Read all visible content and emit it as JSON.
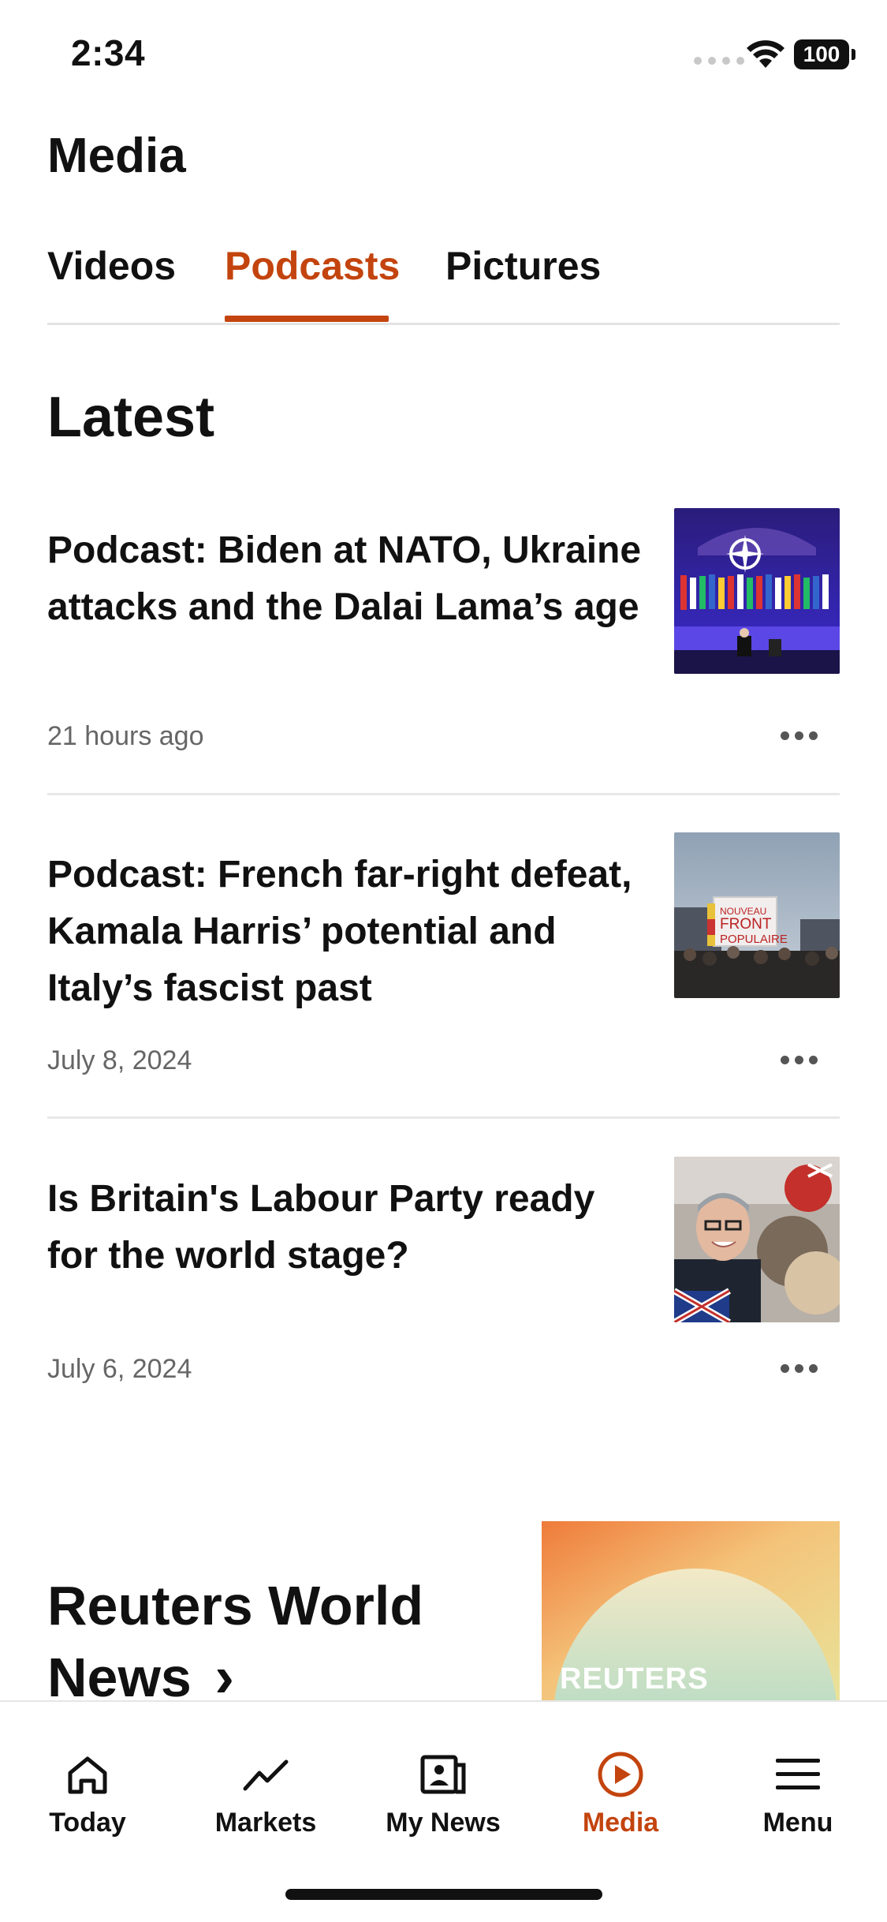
{
  "status_bar": {
    "time": "2:34",
    "battery": "100"
  },
  "header": {
    "title": "Media"
  },
  "tabs": [
    {
      "label": "Videos"
    },
    {
      "label": "Podcasts",
      "active": true
    },
    {
      "label": "Pictures"
    }
  ],
  "section": {
    "title": "Latest"
  },
  "articles": [
    {
      "headline": "Podcast: Biden at NATO, Ukraine attacks and the Dalai Lama’s age",
      "meta": "21 hours ago",
      "thumb": "nato-summit-stage-image"
    },
    {
      "headline": "Podcast: French far-right defeat, Kamala Harris’ potential and Italy’s fascist past",
      "meta": "July 8, 2024",
      "thumb": "front-populaire-crowd-image"
    },
    {
      "headline": "Is Britain's Labour Party ready for the world stage?",
      "meta": "July 6, 2024",
      "thumb": "labour-leader-crowd-image"
    }
  ],
  "feature": {
    "title": "Reuters World News",
    "chevron": "›",
    "thumb_label": "REUTERS"
  },
  "bottom_nav": [
    {
      "label": "Today",
      "icon": "home-icon"
    },
    {
      "label": "Markets",
      "icon": "markets-trend-icon"
    },
    {
      "label": "My News",
      "icon": "my-news-icon"
    },
    {
      "label": "Media",
      "icon": "play-circle-icon",
      "active": true
    },
    {
      "label": "Menu",
      "icon": "hamburger-menu-icon"
    }
  ],
  "colors": {
    "accent": "#c3440e",
    "text": "#111111",
    "meta": "#666666",
    "divider": "#e8e8e8"
  }
}
